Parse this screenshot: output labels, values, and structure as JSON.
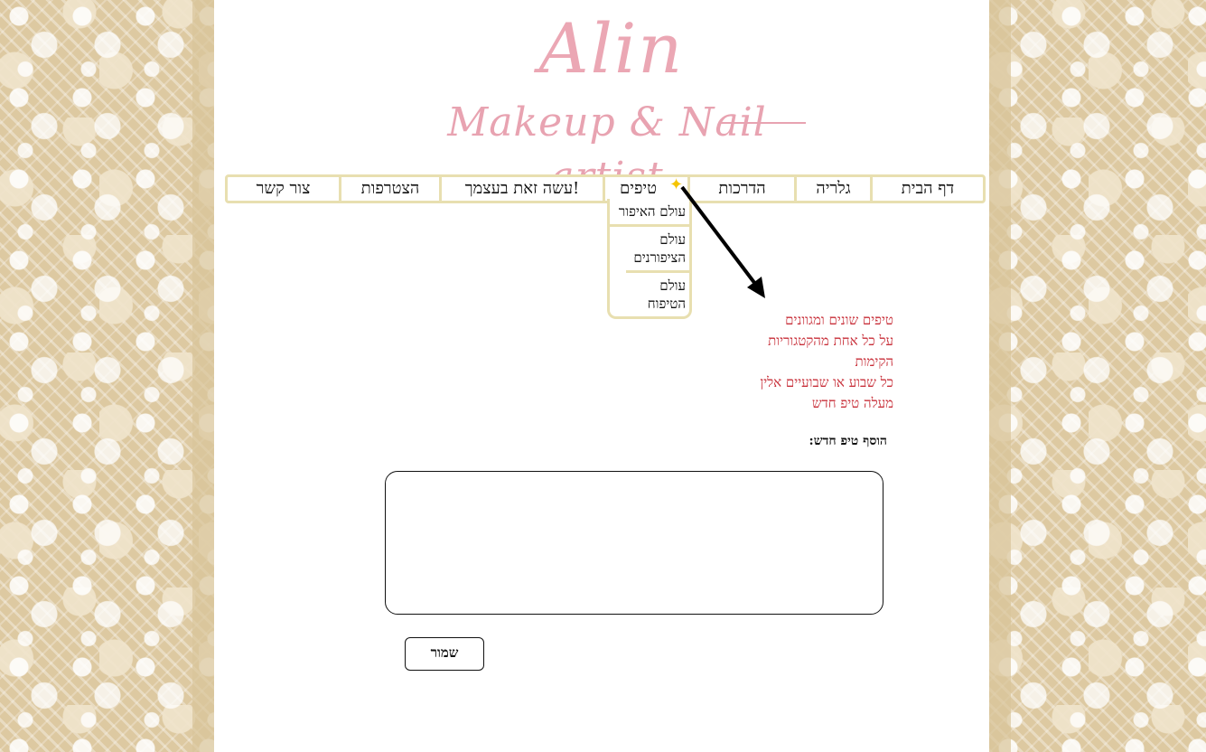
{
  "logo": {
    "title": "Alin",
    "subtitle": "Makeup & Nail artist"
  },
  "nav": {
    "items": [
      {
        "label": "דף הבית"
      },
      {
        "label": "גלריה"
      },
      {
        "label": "הדרכות"
      },
      {
        "label": "טיפים"
      },
      {
        "label": "עשה זאת בעצמך!"
      },
      {
        "label": "הצטרפות"
      },
      {
        "label": "צור קשר"
      }
    ],
    "active_icon": "star-icon"
  },
  "dropdown": {
    "items": [
      {
        "label": "עולם האיפור"
      },
      {
        "label": "עולם הציפורנים"
      },
      {
        "label": "עולם הטיפוח"
      }
    ]
  },
  "note": {
    "lines": [
      "טיפים שונים ומגוונים",
      "על כל אחת מהקטגוריות",
      "הקימות",
      "כל שבוע או שבועיים אלין",
      "מעלה טיפ חדש"
    ],
    "color": "#c8303a"
  },
  "form": {
    "add_label": "הוסף טיפ חדש:",
    "tip_value": "",
    "save_label": "שמור"
  },
  "colors": {
    "logo_pink": "#eba7b4",
    "nav_border": "#e8dfb0",
    "lace_beige": "#ddc9a1",
    "arrow": "#000000"
  }
}
